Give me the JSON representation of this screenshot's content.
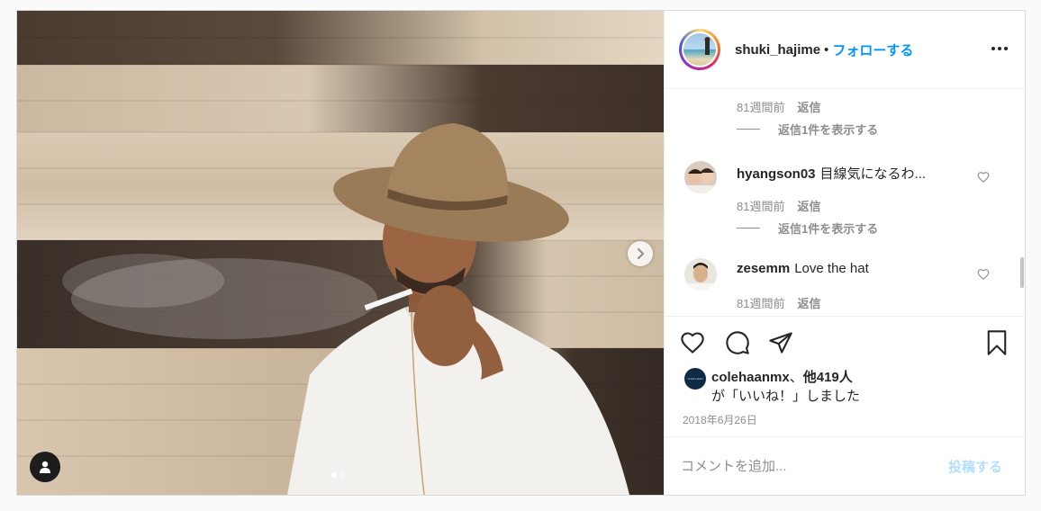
{
  "post": {
    "username": "shuki_hajime",
    "separator": "•",
    "follow_label": "フォローする",
    "more_icon": "more-horizontal-icon"
  },
  "media": {
    "next_icon": "chevron-right-icon",
    "tag_icon": "user-tag-icon",
    "carousel_total": 2,
    "carousel_current": 1
  },
  "comments": {
    "partial": {
      "time": "81週間前",
      "reply_label": "返信",
      "view_replies": "返信1件を表示する"
    },
    "items": [
      {
        "user": "hyangson03",
        "text": "目線気になるわ...",
        "time": "81週間前",
        "reply_label": "返信",
        "view_replies": "返信1件を表示する"
      },
      {
        "user": "zesemm",
        "text": "Love the hat",
        "time": "81週間前",
        "reply_label": "返信"
      }
    ]
  },
  "actions": {
    "like_icon": "heart-icon",
    "comment_icon": "comment-icon",
    "share_icon": "send-icon",
    "save_icon": "bookmark-icon"
  },
  "likes": {
    "avatar_text": "COLE HAAN",
    "user": "colehaanmx",
    "joiner": "、",
    "others": "他419人",
    "suffix": "が「いいね！」しました"
  },
  "date": "2018年6月26日",
  "add_comment": {
    "placeholder": "コメントを追加...",
    "post_label": "投稿する"
  },
  "colors": {
    "accent": "#0095f6",
    "post_disabled": "#b2dffc",
    "meta": "#8e8e8e",
    "text": "#262626",
    "border": "#dbdbdb"
  }
}
